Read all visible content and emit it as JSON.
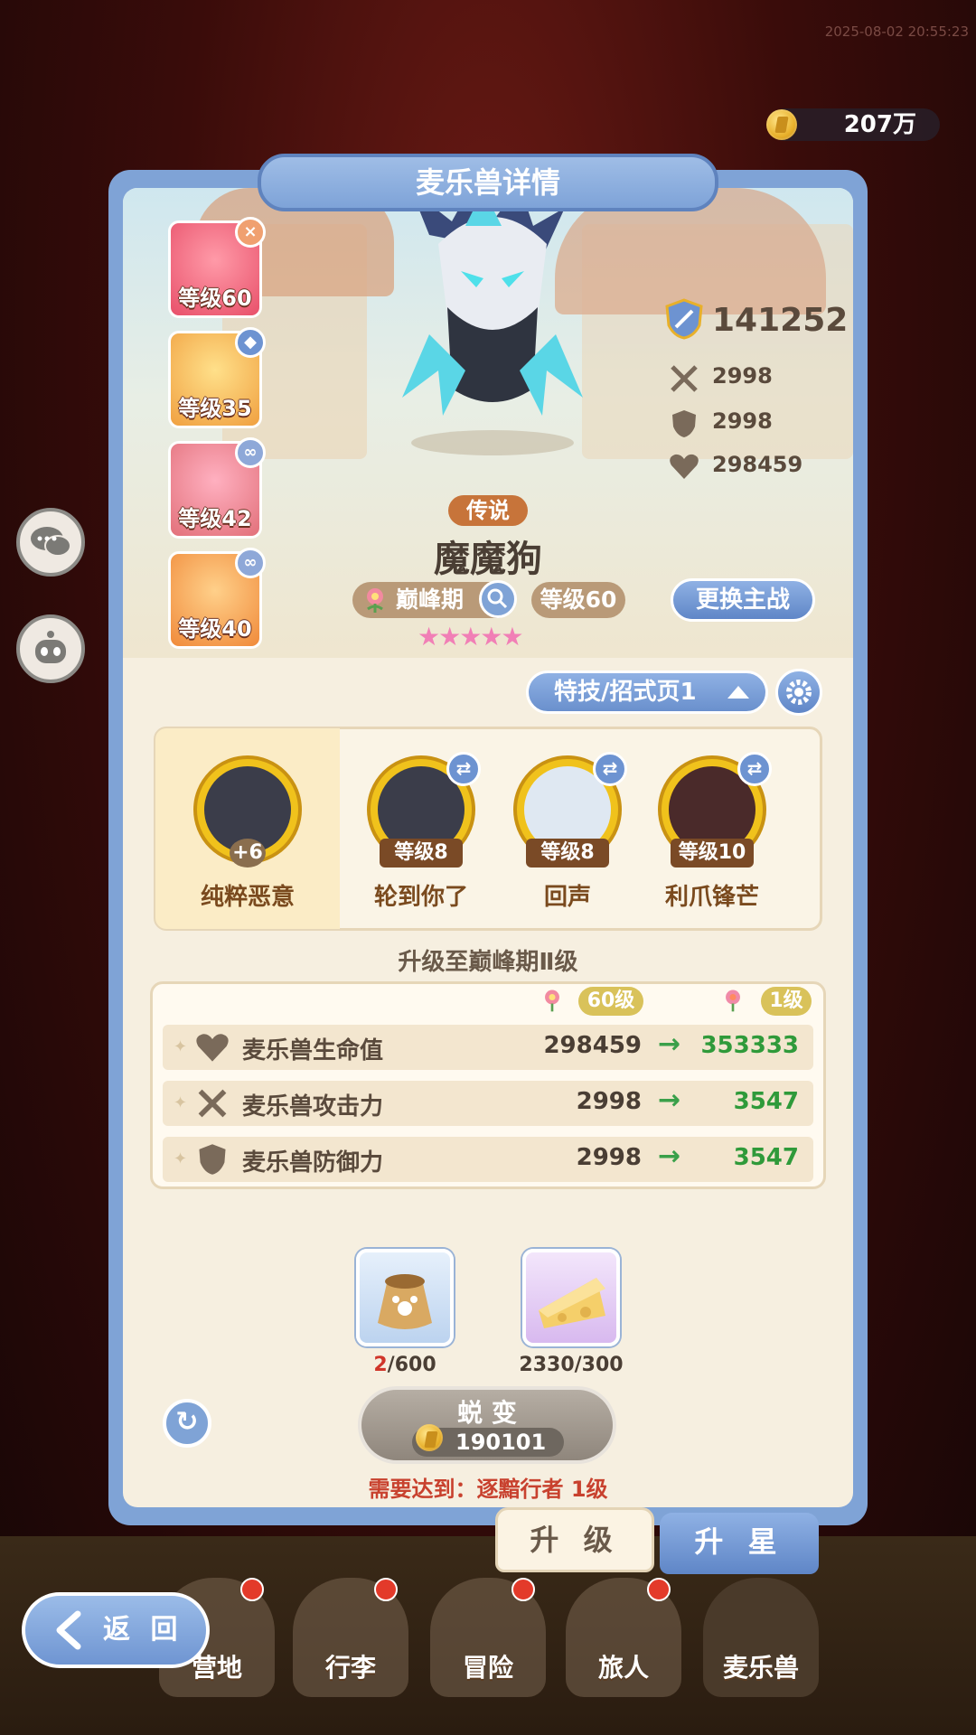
{
  "timestamp": "2025-08-02 20:55:23",
  "currency": {
    "amount": "207万",
    "icon": "gold-coin-icon"
  },
  "panel": {
    "title": "麦乐兽详情"
  },
  "team": [
    {
      "level": "等级60",
      "badge": "×",
      "badge_color": "#f0a070",
      "art_color": "#e8506a"
    },
    {
      "level": "等级35",
      "badge": "◆",
      "badge_color": "#6d93d1",
      "art_color": "#f0a040"
    },
    {
      "level": "等级42",
      "badge": "∞",
      "badge_color": "#8ea8d8",
      "art_color": "#e2707a"
    },
    {
      "level": "等级40",
      "badge": "∞",
      "badge_color": "#8ea8d8",
      "art_color": "#f08a3a"
    }
  ],
  "stats": {
    "power": "141252",
    "attack": "2998",
    "defense": "2998",
    "hp": "298459"
  },
  "pet": {
    "rarity": "传说",
    "name": "魔魔狗",
    "stage": "巅峰期",
    "level": "等级60",
    "stars": "★★★★★"
  },
  "buttons": {
    "switch_main": "更换主战",
    "evolve": "蜕 变",
    "back": "返 回",
    "refresh": "↻"
  },
  "dropdown": {
    "label": "特技/招式页1"
  },
  "skills": [
    {
      "name": "纯粹恶意",
      "level": "+6",
      "selected": true
    },
    {
      "name": "轮到你了",
      "level": "等级8"
    },
    {
      "name": "回声",
      "level": "等级8"
    },
    {
      "name": "利爪锋芒",
      "level": "等级10"
    }
  ],
  "upgrade": {
    "title": "升级至巅峰期Ⅱ级",
    "from_label": "60级",
    "to_label": "1级",
    "rows": [
      {
        "label": "麦乐兽生命值",
        "current": "298459",
        "next": "353333",
        "icon": "heart-icon"
      },
      {
        "label": "麦乐兽攻击力",
        "current": "2998",
        "next": "3547",
        "icon": "crossed-swords-icon"
      },
      {
        "label": "麦乐兽防御力",
        "current": "2998",
        "next": "3547",
        "icon": "shield-icon"
      }
    ]
  },
  "materials": [
    {
      "item": "food-bag-icon",
      "have": "2",
      "need": "/600"
    },
    {
      "item": "cheese-icon",
      "have": "2330",
      "need": "/300"
    }
  ],
  "evolve_cost": "190101",
  "requirement": "需要达到：逐黯行者 1级",
  "tabs": {
    "upgrade": "升 级",
    "star": "升 星"
  },
  "bottom_nav": [
    "营地",
    "行李",
    "冒险",
    "旅人",
    "麦乐兽"
  ]
}
